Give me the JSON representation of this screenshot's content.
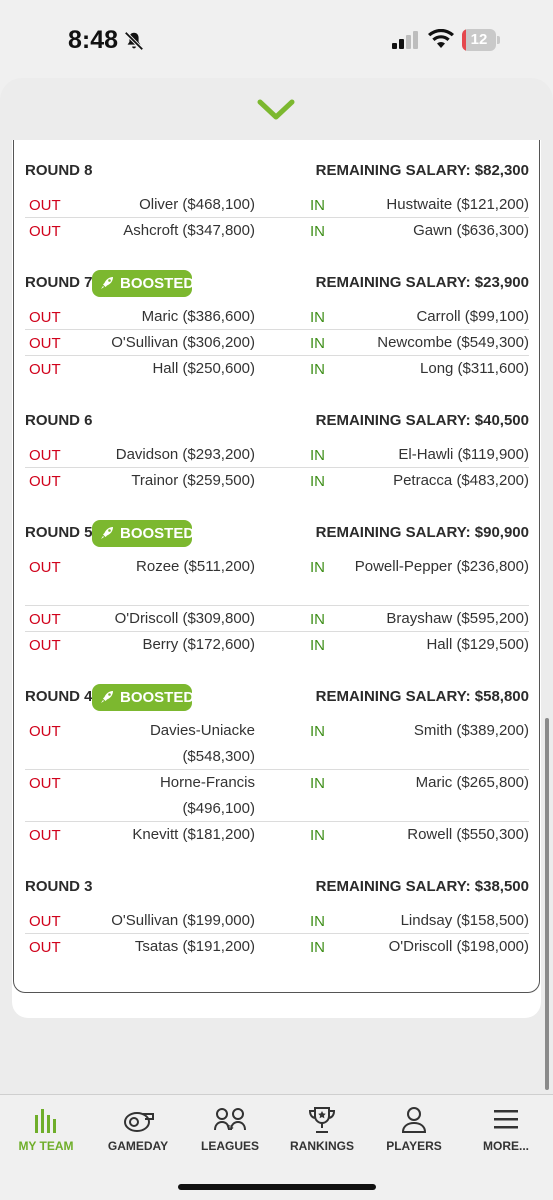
{
  "status_bar": {
    "time": "8:48",
    "battery_level": "12",
    "battery_fraction": 0.12
  },
  "rounds": [
    {
      "title": "ROUND 8",
      "boosted": false,
      "remaining": "REMAINING SALARY: $82,300",
      "trades": [
        {
          "out_label": "OUT",
          "out_player": "Oliver ($468,100)",
          "in_label": "IN",
          "in_player": "Hustwaite ($121,200)"
        },
        {
          "out_label": "OUT",
          "out_player": "Ashcroft ($347,800)",
          "in_label": "IN",
          "in_player": "Gawn ($636,300)"
        }
      ]
    },
    {
      "title": "ROUND 7",
      "boosted": true,
      "boosted_label": "BOOSTED",
      "remaining": "REMAINING SALARY: $23,900",
      "trades": [
        {
          "out_label": "OUT",
          "out_player": "Maric ($386,600)",
          "in_label": "IN",
          "in_player": "Carroll ($99,100)"
        },
        {
          "out_label": "OUT",
          "out_player": "O'Sullivan ($306,200)",
          "in_label": "IN",
          "in_player": "Newcombe ($549,300)"
        },
        {
          "out_label": "OUT",
          "out_player": "Hall ($250,600)",
          "in_label": "IN",
          "in_player": "Long ($311,600)"
        }
      ]
    },
    {
      "title": "ROUND 6",
      "boosted": false,
      "remaining": "REMAINING SALARY: $40,500",
      "trades": [
        {
          "out_label": "OUT",
          "out_player": "Davidson ($293,200)",
          "in_label": "IN",
          "in_player": "El-Hawli ($119,900)"
        },
        {
          "out_label": "OUT",
          "out_player": "Trainor ($259,500)",
          "in_label": "IN",
          "in_player": "Petracca ($483,200)"
        }
      ]
    },
    {
      "title": "ROUND 5",
      "boosted": true,
      "boosted_label": "BOOSTED",
      "remaining": "REMAINING SALARY: $90,900",
      "trades": [
        {
          "out_label": "OUT",
          "out_player": "Rozee ($511,200)",
          "in_label": "IN",
          "in_player": "Powell-Pepper ($236,800)"
        },
        {
          "out_label": "OUT",
          "out_player": "O'Driscoll ($309,800)",
          "in_label": "IN",
          "in_player": "Brayshaw ($595,200)"
        },
        {
          "out_label": "OUT",
          "out_player": "Berry ($172,600)",
          "in_label": "IN",
          "in_player": "Hall ($129,500)"
        }
      ]
    },
    {
      "title": "ROUND 4",
      "boosted": true,
      "boosted_label": "BOOSTED",
      "remaining": "REMAINING SALARY: $58,800",
      "trades": [
        {
          "out_label": "OUT",
          "out_player": "Davies-Uniacke ($548,300)",
          "in_label": "IN",
          "in_player": "Smith ($389,200)"
        },
        {
          "out_label": "OUT",
          "out_player": "Horne-Francis ($496,100)",
          "in_label": "IN",
          "in_player": "Maric ($265,800)"
        },
        {
          "out_label": "OUT",
          "out_player": "Knevitt ($181,200)",
          "in_label": "IN",
          "in_player": "Rowell ($550,300)"
        }
      ]
    },
    {
      "title": "ROUND 3",
      "boosted": false,
      "remaining": "REMAINING SALARY: $38,500",
      "trades": [
        {
          "out_label": "OUT",
          "out_player": "O'Sullivan ($199,000)",
          "in_label": "IN",
          "in_player": "Lindsay ($158,500)"
        },
        {
          "out_label": "OUT",
          "out_player": "Tsatas ($191,200)",
          "in_label": "IN",
          "in_player": "O'Driscoll ($198,000)"
        }
      ]
    }
  ],
  "nav": [
    {
      "label": "MY TEAM",
      "icon": "bar-chart-icon",
      "active": true
    },
    {
      "label": "GAMEDAY",
      "icon": "whistle-icon",
      "active": false
    },
    {
      "label": "LEAGUES",
      "icon": "versus-icon",
      "active": false
    },
    {
      "label": "RANKINGS",
      "icon": "trophy-icon",
      "active": false
    },
    {
      "label": "PLAYERS",
      "icon": "user-icon",
      "active": false
    },
    {
      "label": "MORE...",
      "icon": "menu-icon",
      "active": false
    }
  ],
  "colors": {
    "accent_green": "#7cb82f",
    "out_red": "#d0021b",
    "in_green": "#3f8f1a",
    "nav_active": "#6fae2a"
  }
}
